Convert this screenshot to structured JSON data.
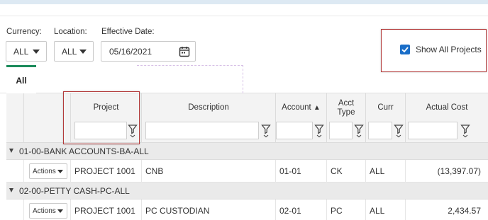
{
  "filters": {
    "currency": {
      "label": "Currency:",
      "value": "ALL"
    },
    "location": {
      "label": "Location:",
      "value": "ALL"
    },
    "effective_date": {
      "label": "Effective Date:",
      "value": "05/16/2021"
    }
  },
  "show_all_projects": {
    "label": "Show All Projects",
    "checked": true
  },
  "tabs": [
    {
      "label": "All",
      "active": true
    }
  ],
  "grid": {
    "columns": {
      "project": "Project",
      "description": "Description",
      "account": "Account",
      "acct_type_1": "Acct",
      "acct_type_2": "Type",
      "curr": "Curr",
      "actual_cost": "Actual Cost"
    },
    "sort_indicator": "▲",
    "actions_label": "Actions",
    "groups": [
      {
        "name": "01-00-BANK ACCOUNTS-BA-ALL",
        "rows": [
          {
            "project": "PROJECT 1001",
            "description": "CNB",
            "account": "01-01",
            "acct_type": "CK",
            "curr": "ALL",
            "actual_cost": "(13,397.07)"
          }
        ]
      },
      {
        "name": "02-00-PETTY CASH-PC-ALL",
        "rows": [
          {
            "project": "PROJECT 1001",
            "description": "PC CUSTODIAN",
            "account": "02-01",
            "acct_type": "PC",
            "curr": "ALL",
            "actual_cost": "2,434.57"
          }
        ]
      }
    ]
  },
  "colors": {
    "accent": "#1a6ec8",
    "tab_active": "#1b8a5a",
    "highlight": "#b33a3a"
  }
}
